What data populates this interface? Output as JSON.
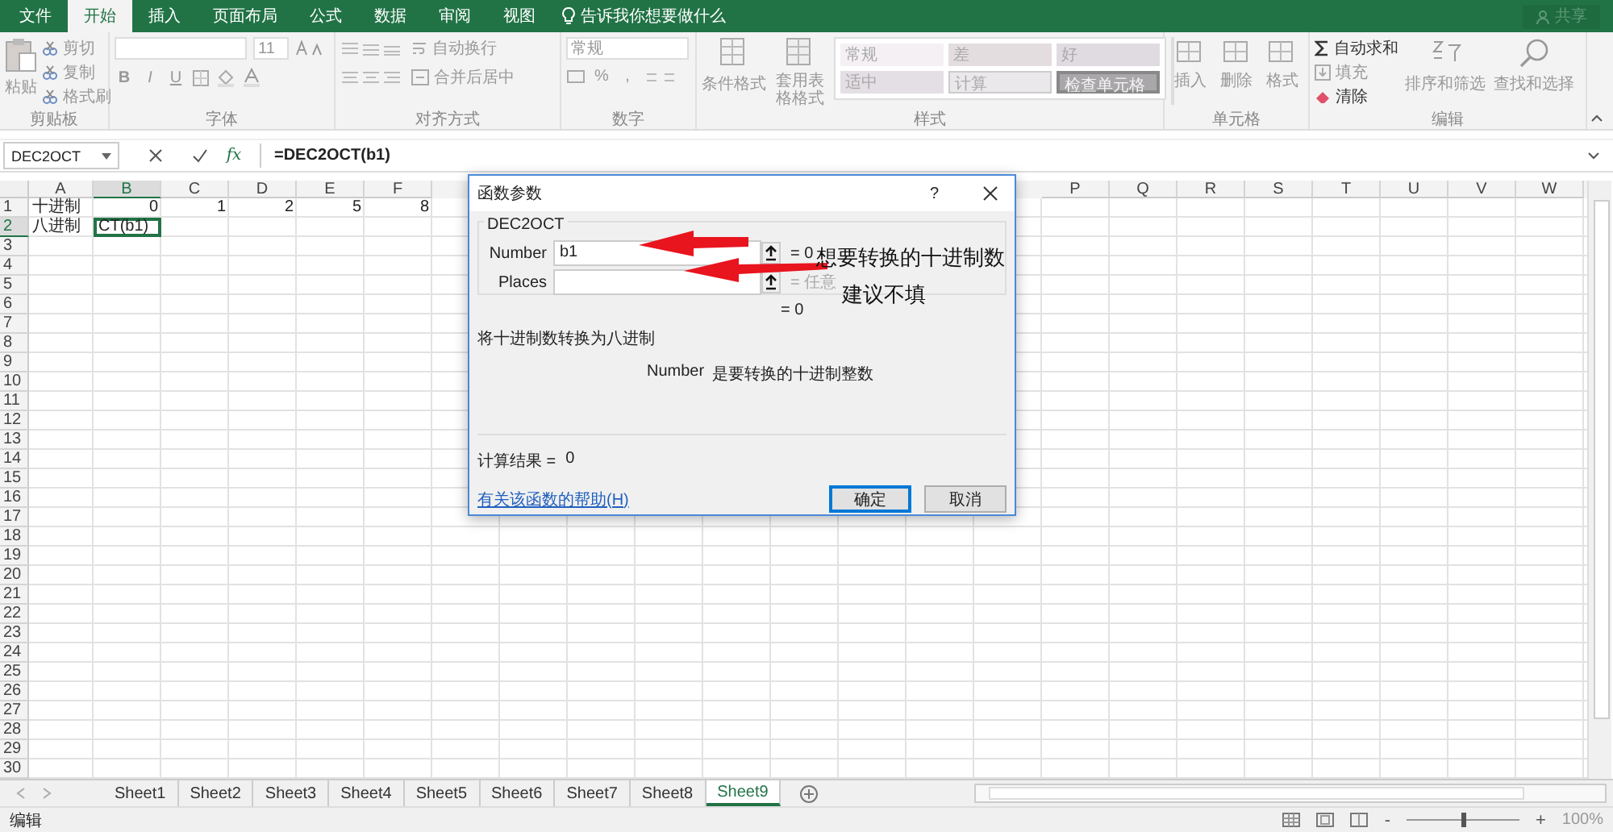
{
  "menu_tabs": [
    {
      "label": "文件",
      "selected": false
    },
    {
      "label": "开始",
      "selected": true
    },
    {
      "label": "插入",
      "selected": false
    },
    {
      "label": "页面布局",
      "selected": false
    },
    {
      "label": "公式",
      "selected": false
    },
    {
      "label": "数据",
      "selected": false
    },
    {
      "label": "审阅",
      "selected": false
    },
    {
      "label": "视图",
      "selected": false
    }
  ],
  "tell_me": "告诉我你想要做什么",
  "share": "共享",
  "ribbon": {
    "clipboard": {
      "paste": "粘贴",
      "items": [
        "剪切",
        "复制",
        "格式刷"
      ],
      "label": "剪贴板"
    },
    "font": {
      "size": "11",
      "format_buttons": [
        "B",
        "I",
        "U"
      ],
      "label": "字体"
    },
    "alignment": {
      "wrap": "自动换行",
      "merge": "合并后居中",
      "label": "对齐方式"
    },
    "number": {
      "format": "常规",
      "buttons": [
        "%",
        ","
      ],
      "label": "数字"
    },
    "styles": {
      "conditional": "条件格式",
      "table_format": "套用表格格式",
      "cell_styles": [
        {
          "label": "常规",
          "kind": "normal"
        },
        {
          "label": "差",
          "kind": "bad"
        },
        {
          "label": "好",
          "kind": "good"
        },
        {
          "label": "适中",
          "kind": "neutral"
        },
        {
          "label": "计算",
          "kind": "calculation"
        },
        {
          "label": "检查单元格",
          "kind": "check"
        }
      ],
      "label": "样式"
    },
    "cells": {
      "buttons": [
        "插入",
        "删除",
        "格式"
      ],
      "label": "单元格"
    },
    "editing": {
      "autosum": "自动求和",
      "fill": "填充",
      "clear": "清除",
      "sort": "排序和筛选",
      "find": "查找和选择",
      "label": "编辑"
    }
  },
  "formula_bar": {
    "name_box": "DEC2OCT",
    "fx": "fx",
    "formula": "=DEC2OCT(b1)"
  },
  "columns_left": [
    "A",
    "B",
    "C",
    "D",
    "E",
    "F"
  ],
  "columns_right": [
    "P",
    "Q",
    "R",
    "S",
    "T",
    "U",
    "V",
    "W"
  ],
  "rows": [
    {
      "number": "1",
      "cells": [
        {
          "text": "十进制",
          "kind": "text",
          "selected": false
        },
        {
          "text": "0",
          "kind": "number",
          "selected": false
        },
        {
          "text": "1",
          "kind": "number",
          "selected": false
        },
        {
          "text": "2",
          "kind": "number",
          "selected": false
        },
        {
          "text": "5",
          "kind": "number",
          "selected": false
        },
        {
          "text": "8",
          "kind": "number",
          "selected": false
        }
      ]
    },
    {
      "number": "2",
      "cells": [
        {
          "text": "八进制",
          "kind": "text",
          "selected": false
        },
        {
          "text": "CT(b1)",
          "kind": "text",
          "selected": true
        }
      ]
    },
    {
      "number": "3",
      "cells": []
    },
    {
      "number": "4",
      "cells": []
    },
    {
      "number": "5",
      "cells": []
    },
    {
      "number": "6",
      "cells": []
    },
    {
      "number": "7",
      "cells": []
    },
    {
      "number": "8",
      "cells": []
    },
    {
      "number": "9",
      "cells": []
    },
    {
      "number": "10",
      "cells": []
    },
    {
      "number": "11",
      "cells": []
    },
    {
      "number": "12",
      "cells": []
    },
    {
      "number": "13",
      "cells": []
    },
    {
      "number": "14",
      "cells": []
    },
    {
      "number": "15",
      "cells": []
    },
    {
      "number": "16",
      "cells": []
    },
    {
      "number": "17",
      "cells": []
    },
    {
      "number": "18",
      "cells": []
    },
    {
      "number": "19",
      "cells": []
    },
    {
      "number": "20",
      "cells": []
    },
    {
      "number": "21",
      "cells": []
    },
    {
      "number": "22",
      "cells": []
    },
    {
      "number": "23",
      "cells": []
    },
    {
      "number": "24",
      "cells": []
    },
    {
      "number": "25",
      "cells": []
    },
    {
      "number": "26",
      "cells": []
    },
    {
      "number": "27",
      "cells": []
    },
    {
      "number": "28",
      "cells": []
    },
    {
      "number": "29",
      "cells": []
    },
    {
      "number": "30",
      "cells": []
    }
  ],
  "dialog": {
    "title": "函数参数",
    "help": "?",
    "function_name": "DEC2OCT",
    "arguments": [
      {
        "label": "Number",
        "value": "b1",
        "result": "= 0",
        "optional": false
      },
      {
        "label": "Places",
        "result": "= 任意",
        "optional": true
      }
    ],
    "formula_result": "= 0",
    "description": "将十进制数转换为八进制",
    "arg_name": "Number",
    "arg_description": "是要转换的十进制整数",
    "result_label": "计算结果 =",
    "result_value": "0",
    "help_link": "有关该函数的帮助(H)",
    "buttons": [
      {
        "label": "确定",
        "default": true
      },
      {
        "label": "取消",
        "default": false
      }
    ]
  },
  "annotations": [
    "想要转换的十进制数",
    "建议不填"
  ],
  "sheet_tabs": [
    {
      "label": "Sheet1",
      "selected": false
    },
    {
      "label": "Sheet2",
      "selected": false
    },
    {
      "label": "Sheet3",
      "selected": false
    },
    {
      "label": "Sheet4",
      "selected": false
    },
    {
      "label": "Sheet5",
      "selected": false
    },
    {
      "label": "Sheet6",
      "selected": false
    },
    {
      "label": "Sheet7",
      "selected": false
    },
    {
      "label": "Sheet8",
      "selected": false
    },
    {
      "label": "Sheet9",
      "selected": true
    }
  ],
  "status_bar": {
    "mode": "编辑",
    "zoom": {
      "minus": "-",
      "plus": "+",
      "level": 0.5,
      "reading": "100%"
    }
  }
}
